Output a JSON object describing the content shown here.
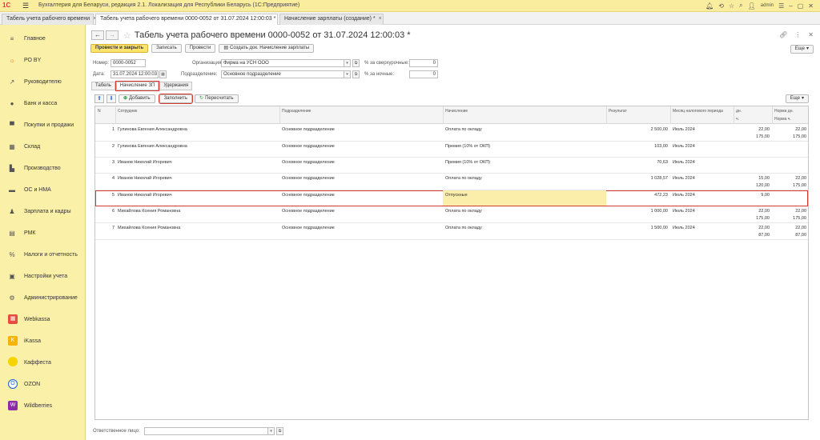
{
  "app": {
    "title": "Бухгалтерия для Беларуси, редакция 2.1. Локализация для Республики Беларусь   (1С:Предприятие)",
    "logo": "1С",
    "user": "admin"
  },
  "doc_tabs": [
    {
      "label": "Табель учета рабочего времени",
      "active": false
    },
    {
      "label": "Табель учета рабочего времени 0000-0052 от 31.07.2024 12:00:03 *",
      "active": true
    },
    {
      "label": "Начисление зарплаты (создание) *",
      "active": false
    }
  ],
  "sidebar": {
    "items": [
      {
        "label": "Главное",
        "icon": "menu-icon"
      },
      {
        "label": "РО BY",
        "icon": "sun-icon"
      },
      {
        "label": "Руководителю",
        "icon": "trend-icon"
      },
      {
        "label": "Банк и касса",
        "icon": "coin-icon"
      },
      {
        "label": "Покупки и продажи",
        "icon": "cart-icon"
      },
      {
        "label": "Склад",
        "icon": "warehouse-icon"
      },
      {
        "label": "Производство",
        "icon": "factory-icon"
      },
      {
        "label": "ОС и НМА",
        "icon": "truck-icon"
      },
      {
        "label": "Зарплата и кадры",
        "icon": "person-icon"
      },
      {
        "label": "РМК",
        "icon": "register-icon"
      },
      {
        "label": "Налоги и отчетность",
        "icon": "tax-icon"
      },
      {
        "label": "Настройки учета",
        "icon": "settings-doc-icon"
      },
      {
        "label": "Администрирование",
        "icon": "gear-icon"
      },
      {
        "label": "Webkassa",
        "icon": "webkassa-icon"
      },
      {
        "label": "iKassa",
        "icon": "ikassa-icon"
      },
      {
        "label": "Каффеста",
        "icon": "kaffesta-icon"
      },
      {
        "label": "OZON",
        "icon": "ozon-icon"
      },
      {
        "label": "Wildberries",
        "icon": "wildberries-icon"
      }
    ]
  },
  "document": {
    "title": "Табель учета рабочего времени 0000-0052 от 31.07.2024 12:00:03 *"
  },
  "toolbar": {
    "post_close": "Провести и закрыть",
    "save": "Записать",
    "post": "Провести",
    "create_based": "Создать док. Начисление зарплаты",
    "more": "Еще"
  },
  "form": {
    "number_label": "Номер:",
    "number_value": "0000-0052",
    "date_label": "Дата:",
    "date_value": "31.07.2024 12:00:03",
    "org_label": "Организация:",
    "org_value": "Фирма на УСН ООО",
    "dept_label": "Подразделение:",
    "dept_value": "Основное подразделение",
    "overtime_label": "% за сверхурочные:",
    "overtime_value": "0",
    "night_label": "% за ночные:",
    "night_value": "0"
  },
  "subtabs": {
    "tab1": "Табель",
    "tab2": "Начисление ЗП",
    "tab3": "Удержания"
  },
  "table_toolbar": {
    "add": "Добавить",
    "fill": "Заполнить",
    "recalc": "Пересчитать",
    "more": "Еще"
  },
  "table": {
    "headers": {
      "n": "N",
      "employee": "Сотрудник",
      "dept": "Подразделение",
      "accrual": "Начисление",
      "result": "Результат",
      "tax_month": "Месяц налогового периода",
      "days": "дн.",
      "hours": "ч.",
      "norm_days": "Норма дн.",
      "norm_hours": "Норма ч."
    },
    "rows": [
      {
        "n": "1",
        "employee": "Гулинова Евгения Александровна",
        "dept": "Основное подразделение",
        "accrual": "Оплата по окладу",
        "result": "2 500,00",
        "month": "Июль 2024",
        "days": "22,00",
        "hours": "175,00",
        "norm_days": "22,00",
        "norm_hours": "175,00",
        "selected": false
      },
      {
        "n": "2",
        "employee": "Гулинова Евгения Александровна",
        "dept": "Основное подразделение",
        "accrual": "Премия (10% от ОКП)",
        "result": "103,00",
        "month": "Июль 2024",
        "days": "",
        "hours": "",
        "norm_days": "",
        "norm_hours": "",
        "selected": false
      },
      {
        "n": "3",
        "employee": "Иванов Николай Игоревич",
        "dept": "Основное подразделение",
        "accrual": "Премия (10% от ОКП)",
        "result": "70,63",
        "month": "Июль 2024",
        "days": "",
        "hours": "",
        "norm_days": "",
        "norm_hours": "",
        "selected": false
      },
      {
        "n": "4",
        "employee": "Иванов Николай Игоревич",
        "dept": "Основное подразделение",
        "accrual": "Оплата по окладу",
        "result": "1 028,57",
        "month": "Июль 2024",
        "days": "15,00",
        "hours": "120,00",
        "norm_days": "22,00",
        "norm_hours": "175,00",
        "selected": false
      },
      {
        "n": "5",
        "employee": "Иванов Николай Игоревич",
        "dept": "Основное подразделение",
        "accrual": "Отпускные",
        "result": "472,23",
        "month": "Июль 2024",
        "days": "9,00",
        "hours": "",
        "norm_days": "",
        "norm_hours": "",
        "selected": true
      },
      {
        "n": "6",
        "employee": "Михайлова Ксения Романовна",
        "dept": "Основное подразделение",
        "accrual": "Оплата по окладу",
        "result": "1 000,00",
        "month": "Июль 2024",
        "days": "22,00",
        "hours": "175,00",
        "norm_days": "22,00",
        "norm_hours": "175,00",
        "selected": false
      },
      {
        "n": "7",
        "employee": "Михайлова Ксения Романовна",
        "dept": "Основное подразделение",
        "accrual": "Оплата по окладу",
        "result": "1 500,00",
        "month": "Июль 2024",
        "days": "22,00",
        "hours": "87,00",
        "norm_days": "22,00",
        "norm_hours": "87,00",
        "selected": false
      }
    ]
  },
  "footer": {
    "responsible_label": "Ответственное лицо:",
    "responsible_value": ""
  },
  "colors": {
    "sidebar_bg": "#fbf0a8",
    "topbar_bg": "#fbed9e",
    "primary_button": "#fce36e",
    "highlight_outline": "#d43b2f",
    "selected_cell": "#fbeeaa"
  }
}
